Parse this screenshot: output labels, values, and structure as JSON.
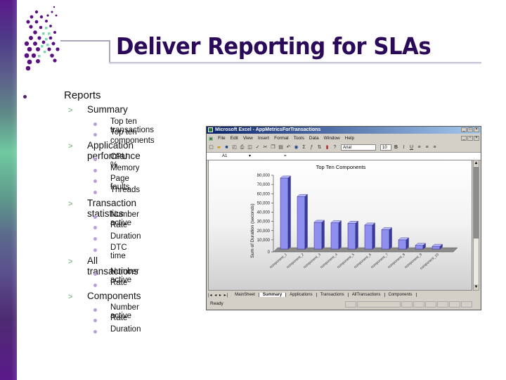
{
  "slide": {
    "title": "Deliver Reporting for SLAs"
  },
  "outline": {
    "level1": "Reports",
    "sections": [
      {
        "label": "Summary",
        "items": [
          "Top ten transactions",
          "Top ten components"
        ]
      },
      {
        "label": "Application performance",
        "items": [
          "CPU %",
          "Memory",
          "Page faults",
          "Threads"
        ]
      },
      {
        "label": "Transaction statistics",
        "items": [
          "Number active",
          "Rate",
          "Duration",
          "DTC time"
        ]
      },
      {
        "label": "All transactions",
        "items": [
          "Number active",
          "Rate"
        ]
      },
      {
        "label": "Components",
        "items": [
          "Number active",
          "Rate",
          "Duration"
        ]
      }
    ]
  },
  "excel": {
    "window_title": "Microsoft Excel - AppMetricsForTransactions",
    "menu": [
      "File",
      "Edit",
      "View",
      "Insert",
      "Format",
      "Tools",
      "Data",
      "Window",
      "Help"
    ],
    "font_name": "Arial",
    "font_size": "10",
    "cell_ref": "A1",
    "formula_eq": "=",
    "sheet_tabs": [
      "MainSheet",
      "Summary",
      "Applications",
      "Transactions",
      "AllTransactions",
      "Components"
    ],
    "active_tab": "Summary",
    "status": "Ready"
  },
  "chart_data": {
    "type": "bar",
    "title": "Top Ten Components",
    "xlabel": "",
    "ylabel": "Sum of Duration (seconds)",
    "ylim": [
      0,
      80000
    ],
    "yticks": [
      "0",
      "10,000",
      "20,000",
      "30,000",
      "40,000",
      "50,000",
      "60,000",
      "70,000",
      "80,000"
    ],
    "categories": [
      "component_1",
      "component_2",
      "component_3",
      "component_4",
      "component_5",
      "component_6",
      "component_7",
      "component_8",
      "component_9",
      "component_10"
    ],
    "values": [
      77000,
      57000,
      29000,
      28500,
      28000,
      26000,
      21000,
      10000,
      4000,
      3000
    ],
    "bar_color": "#8f8ff0",
    "grid": false,
    "style": "3d-column"
  }
}
